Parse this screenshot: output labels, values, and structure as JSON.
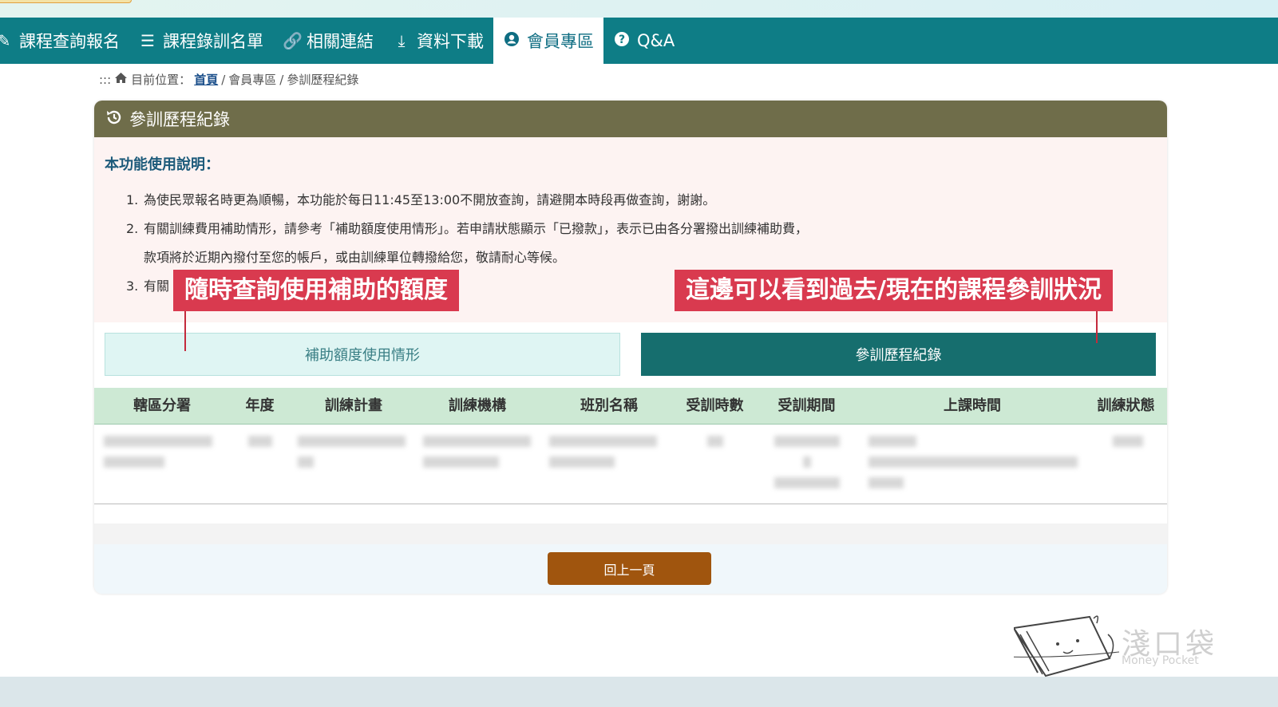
{
  "nav": {
    "items": [
      {
        "label": "課程查詢報名",
        "icon": "pencil-icon"
      },
      {
        "label": "課程錄訓名單",
        "icon": "list-icon"
      },
      {
        "label": "相關連結",
        "icon": "link-icon"
      },
      {
        "label": "資料下載",
        "icon": "download-icon"
      },
      {
        "label": "會員專區",
        "icon": "user-circle-icon",
        "active": true
      },
      {
        "label": "Q&A",
        "icon": "question-circle-icon"
      }
    ]
  },
  "breadcrumb": {
    "prefix": ":::",
    "label": "目前位置：",
    "home": "首頁",
    "sep1": " / ",
    "section": "會員專區",
    "sep2": " / ",
    "current": "參訓歷程紀錄"
  },
  "panel": {
    "title": "參訓歷程紀錄",
    "notice_title": "本功能使用說明：",
    "notes": {
      "n1_num": "1.",
      "n1": "為使民眾報名時更為順暢，本功能於每日11:45至13:00不開放查詢，請避開本時段再做查詢，謝謝。",
      "n2_num": "2.",
      "n2": "有關訓練費用補助情形，請參考「補助額度使用情形」。若申請狀態顯示「已撥款」，表示已由各分署撥出訓練補助費，",
      "n2_cont": "款項將於近期內撥付至您的帳戶，或由訓練單位轉撥給您，敬請耐心等候。",
      "n3_num": "3.",
      "n3": "有關"
    },
    "btn_subsidy": "補助額度使用情形",
    "btn_history": "參訓歷程紀錄",
    "columns": [
      "轄區分署",
      "年度",
      "訓練計畫",
      "訓練機構",
      "班別名稱",
      "受訓時數",
      "受訓期間",
      "上課時間",
      "訓練狀態"
    ],
    "back_button": "回上一頁"
  },
  "annotations": {
    "left": "隨時查詢使用補助的額度",
    "right": "這邊可以看到過去/現在的課程參訓狀況"
  },
  "watermark": {
    "name": "淺口袋",
    "sub": "Money Pocket"
  },
  "colors": {
    "nav_bg": "#0e7d86",
    "panel_head": "#6f6d4a",
    "callout": "#d93a4f",
    "back_button": "#a0550e"
  }
}
